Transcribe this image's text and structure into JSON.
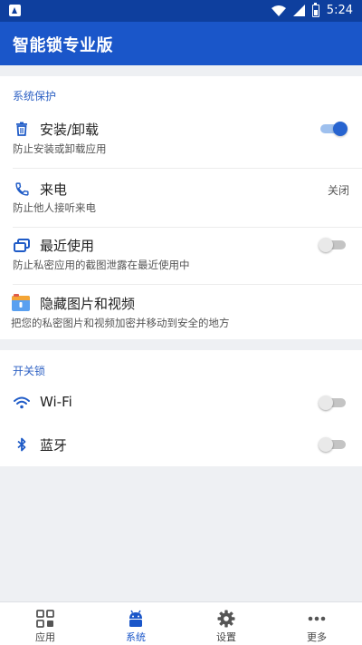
{
  "status_bar": {
    "time": "5:24"
  },
  "app_bar": {
    "title": "智能锁专业版"
  },
  "system_protection": {
    "section_title": "系统保护",
    "items": [
      {
        "icon": "trash-icon",
        "label": "安装/卸载",
        "description": "防止安装或卸载应用",
        "toggle": true
      },
      {
        "icon": "phone-icon",
        "label": "来电",
        "description": "防止他人接听来电",
        "value": "关闭"
      },
      {
        "icon": "recent-apps-icon",
        "label": "最近使用",
        "description": "防止私密应用的截图泄露在最近使用中",
        "toggle": false
      },
      {
        "icon": "vault-icon",
        "label": "隐藏图片和视频",
        "description": "把您的私密图片和视频加密并移动到安全的地方"
      }
    ]
  },
  "switch_locks": {
    "section_title": "开关锁",
    "items": [
      {
        "icon": "wifi-icon",
        "label": "Wi-Fi",
        "toggle": false
      },
      {
        "icon": "bluetooth-icon",
        "label": "蓝牙",
        "toggle": false
      }
    ]
  },
  "bottom_nav": {
    "items": [
      {
        "icon": "apps-grid-icon",
        "label": "应用"
      },
      {
        "icon": "android-icon",
        "label": "系统",
        "active": true
      },
      {
        "icon": "gear-icon",
        "label": "设置"
      },
      {
        "icon": "more-dots-icon",
        "label": "更多"
      }
    ]
  },
  "colors": {
    "primary": "#1a56c9",
    "status_bar": "#0e3f9e",
    "accent_text": "#2f62c4",
    "background": "#eef0f3"
  }
}
